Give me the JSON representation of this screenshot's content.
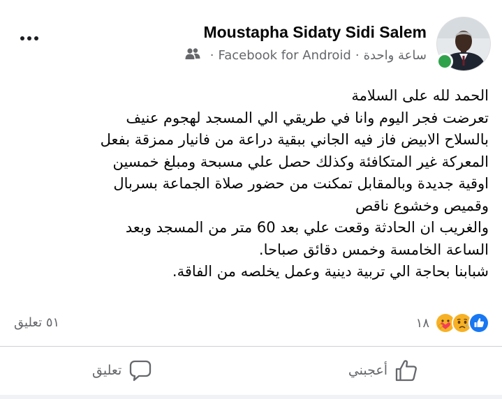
{
  "post": {
    "author_name": "Moustapha Sidaty Sidi Salem",
    "time": "ساعة واحدة",
    "separator": "·",
    "via": "Facebook for Android",
    "audience_icon": "friends-icon",
    "online": true,
    "text_lines": [
      "الحمد لله على السلامة",
      "تعرضت فجر اليوم وانا في طريقي الي المسجد لهجوم عنيف",
      "بالسلاح الابيض فاز فيه الجاني ببقية دراعة من فانيار ممزقة بفعل",
      "المعركة غير المتكافئة وكذلك حصل علي مسبحة ومبلغ خمسين",
      "اوقية جديدة وبالمقابل تمكنت من حضور صلاة الجماعة بسربال",
      "وقميص وخشوع ناقص",
      "والغريب ان الحادثة وقعت علي بعد 60 متر من المسجد وبعد",
      "الساعة الخامسة وخمس دقائق صباحا.",
      "شبابنا بحاجة الي تربية دينية وعمل يخلصه من الفاقة."
    ]
  },
  "stats": {
    "reaction_count": "١٨",
    "reaction_icons": [
      "like-reaction-icon",
      "sad-reaction-icon",
      "care-reaction-icon"
    ],
    "comments": "٥١ تعليق"
  },
  "actions": {
    "like_label": "أعجبني",
    "comment_label": "تعليق"
  },
  "colors": {
    "like_blue": "#1877f2",
    "online_green": "#31a24c",
    "reaction_yellow": "#f7b125",
    "secondary_text": "#65676b"
  }
}
